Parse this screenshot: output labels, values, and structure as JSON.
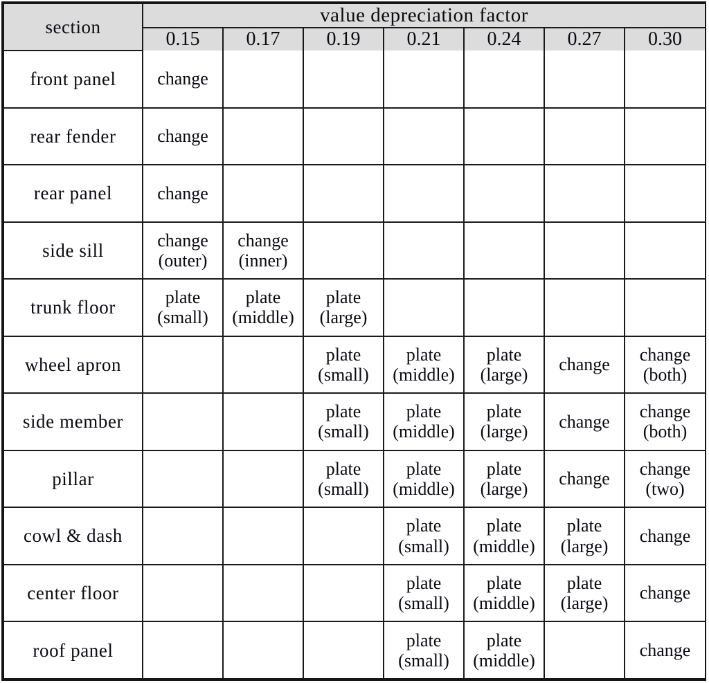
{
  "table": {
    "section_header": "section",
    "group_header": "value depreciation factor",
    "columns": [
      "0.15",
      "0.17",
      "0.19",
      "0.21",
      "0.24",
      "0.27",
      "0.30"
    ],
    "colors": {
      "header_background": "#dcdcdc",
      "cell_background": "#ffffff",
      "border": "#1a1a1a",
      "outer_border": "#151515",
      "text": "#0a0a12"
    },
    "rows": [
      {
        "label": "front panel",
        "cells": [
          "change",
          "",
          "",
          "",
          "",
          "",
          ""
        ]
      },
      {
        "label": "rear fender",
        "cells": [
          "change",
          "",
          "",
          "",
          "",
          "",
          ""
        ]
      },
      {
        "label": "rear panel",
        "cells": [
          "change",
          "",
          "",
          "",
          "",
          "",
          ""
        ]
      },
      {
        "label": "side sill",
        "cells": [
          "change\n(outer)",
          "change\n(inner)",
          "",
          "",
          "",
          "",
          ""
        ]
      },
      {
        "label": "trunk floor",
        "cells": [
          "plate\n(small)",
          "plate\n(middle)",
          "plate\n(large)",
          "",
          "",
          "",
          ""
        ]
      },
      {
        "label": "wheel apron",
        "cells": [
          "",
          "",
          "plate\n(small)",
          "plate\n(middle)",
          "plate\n(large)",
          "change",
          "change\n(both)"
        ]
      },
      {
        "label": "side member",
        "cells": [
          "",
          "",
          "plate\n(small)",
          "plate\n(middle)",
          "plate\n(large)",
          "change",
          "change\n(both)"
        ]
      },
      {
        "label": "pillar",
        "cells": [
          "",
          "",
          "plate\n(small)",
          "plate\n(middle)",
          "plate\n(large)",
          "change",
          "change\n(two)"
        ]
      },
      {
        "label": "cowl & dash",
        "cells": [
          "",
          "",
          "",
          "plate\n(small)",
          "plate\n(middle)",
          "plate\n(large)",
          "change"
        ]
      },
      {
        "label": "center floor",
        "cells": [
          "",
          "",
          "",
          "plate\n(small)",
          "plate\n(middle)",
          "plate\n(large)",
          "change"
        ]
      },
      {
        "label": "roof panel",
        "cells": [
          "",
          "",
          "",
          "plate\n(small)",
          "plate\n(middle)",
          "",
          "change"
        ]
      }
    ]
  }
}
